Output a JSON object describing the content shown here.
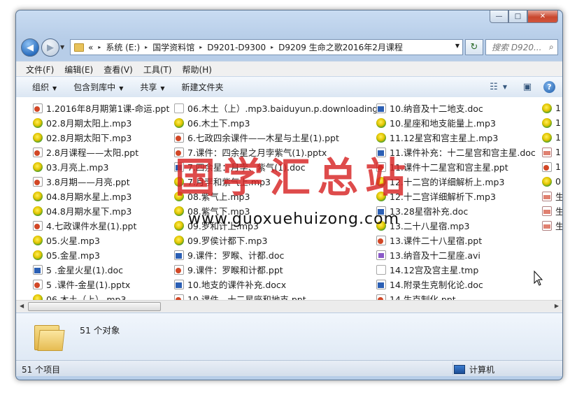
{
  "window_controls": {
    "minimize": "—",
    "maximize": "□",
    "close": "✕"
  },
  "address_bar": {
    "crumbs": [
      "«",
      "系统 (E:)",
      "国学资料馆",
      "D9201-D9300",
      "D9209 生命之歌2016年2月课程"
    ]
  },
  "search": {
    "placeholder": "搜索 D920..."
  },
  "menu": [
    "文件(F)",
    "编辑(E)",
    "查看(V)",
    "工具(T)",
    "帮助(H)"
  ],
  "toolbar": {
    "organize": "组织",
    "include_library": "包含到库中",
    "share": "共享",
    "new_folder": "新建文件夹"
  },
  "columns": [
    [
      {
        "name": "1.2016年8月期第1课-命运.ppt",
        "type": "ppt"
      },
      {
        "name": "02.8月期太阳上.mp3",
        "type": "mp3"
      },
      {
        "name": "02.8月期太阳下.mp3",
        "type": "mp3"
      },
      {
        "name": "2.8月课程——太阳.ppt",
        "type": "ppt"
      },
      {
        "name": "03.月亮上.mp3",
        "type": "mp3"
      },
      {
        "name": "3.8月期——月亮.ppt",
        "type": "ppt"
      },
      {
        "name": "04.8月期水星上.mp3",
        "type": "mp3"
      },
      {
        "name": "04.8月期水星下.mp3",
        "type": "mp3"
      },
      {
        "name": "4.七政课件水星(1).ppt",
        "type": "ppt"
      },
      {
        "name": "05.火星.mp3",
        "type": "mp3"
      },
      {
        "name": "05.金星.mp3",
        "type": "mp3"
      },
      {
        "name": "5 .金星火星(1).doc",
        "type": "doc"
      },
      {
        "name": "5 .课件-金星(1).pptx",
        "type": "pptx"
      },
      {
        "name": "06.木土（上）.mp3",
        "type": "mp3"
      }
    ],
    [
      {
        "name": "06.木土（上）.mp3.baiduyun.p.downloading",
        "type": "blank"
      },
      {
        "name": "06.木土下.mp3",
        "type": "mp3"
      },
      {
        "name": "6.七政四余课件——木星与土星(1).ppt",
        "type": "ppt"
      },
      {
        "name": "7.课件：四余星之月孛紫气(1).pptx",
        "type": "pptx"
      },
      {
        "name": "7.四余星：月孛、紫气(1).doc",
        "type": "doc"
      },
      {
        "name": "7.月孛和紫气上.mp3",
        "type": "mp3"
      },
      {
        "name": "08.紫气上.mp3",
        "type": "mp3"
      },
      {
        "name": "08.紫气下.mp3",
        "type": "mp3"
      },
      {
        "name": "09.罗和计上.mp3",
        "type": "mp3"
      },
      {
        "name": "09.罗侯计都下.mp3",
        "type": "mp3"
      },
      {
        "name": "9.课件：罗睺、计都.doc",
        "type": "doc"
      },
      {
        "name": "9.课件：罗睺和计都.ppt",
        "type": "ppt"
      },
      {
        "name": "10.地支的课件补充.docx",
        "type": "docx"
      },
      {
        "name": "10.课件—十二星座和地支.ppt",
        "type": "ppt"
      }
    ],
    [
      {
        "name": "10.纳音及十二地支.doc",
        "type": "doc"
      },
      {
        "name": "10.星座和地支能量上.mp3",
        "type": "mp3"
      },
      {
        "name": "11.12星宫和宫主星上.mp3",
        "type": "mp3"
      },
      {
        "name": "11.课件补充：十二星宫和宫主星.doc",
        "type": "doc"
      },
      {
        "name": "11.课件十二星宫和宫主星.ppt",
        "type": "ppt"
      },
      {
        "name": "12.十二宫的详细解析上.mp3",
        "type": "mp3"
      },
      {
        "name": "12.十二宫详细解析下.mp3",
        "type": "mp3"
      },
      {
        "name": "13.28星宿补充.doc",
        "type": "doc"
      },
      {
        "name": "13.二十八星宿.mp3",
        "type": "mp3"
      },
      {
        "name": "13.课件二十八星宿.ppt",
        "type": "ppt"
      },
      {
        "name": "13.纳音及十二星座.avi",
        "type": "avi"
      },
      {
        "name": "14.12宫及宫主星.tmp",
        "type": "blank"
      },
      {
        "name": "14.附录生克制化论.doc",
        "type": "doc"
      },
      {
        "name": "14.生克制化.ppt",
        "type": "ppt"
      }
    ],
    [
      {
        "name": "1",
        "type": "mp3"
      },
      {
        "name": "1",
        "type": "mp3"
      },
      {
        "name": "1",
        "type": "mp3"
      },
      {
        "name": "1",
        "type": "mdf"
      },
      {
        "name": "1",
        "type": "ppt"
      },
      {
        "name": "0",
        "type": "mp3"
      },
      {
        "name": "生",
        "type": "mdf"
      },
      {
        "name": "生",
        "type": "mdf"
      },
      {
        "name": "生",
        "type": "mdf"
      }
    ]
  ],
  "watermark": {
    "title": "国学汇总站",
    "url": "www.guoxuehuizong.com"
  },
  "details": {
    "count": "51 个对象"
  },
  "status": {
    "items": "51 个项目",
    "location": "计算机"
  }
}
